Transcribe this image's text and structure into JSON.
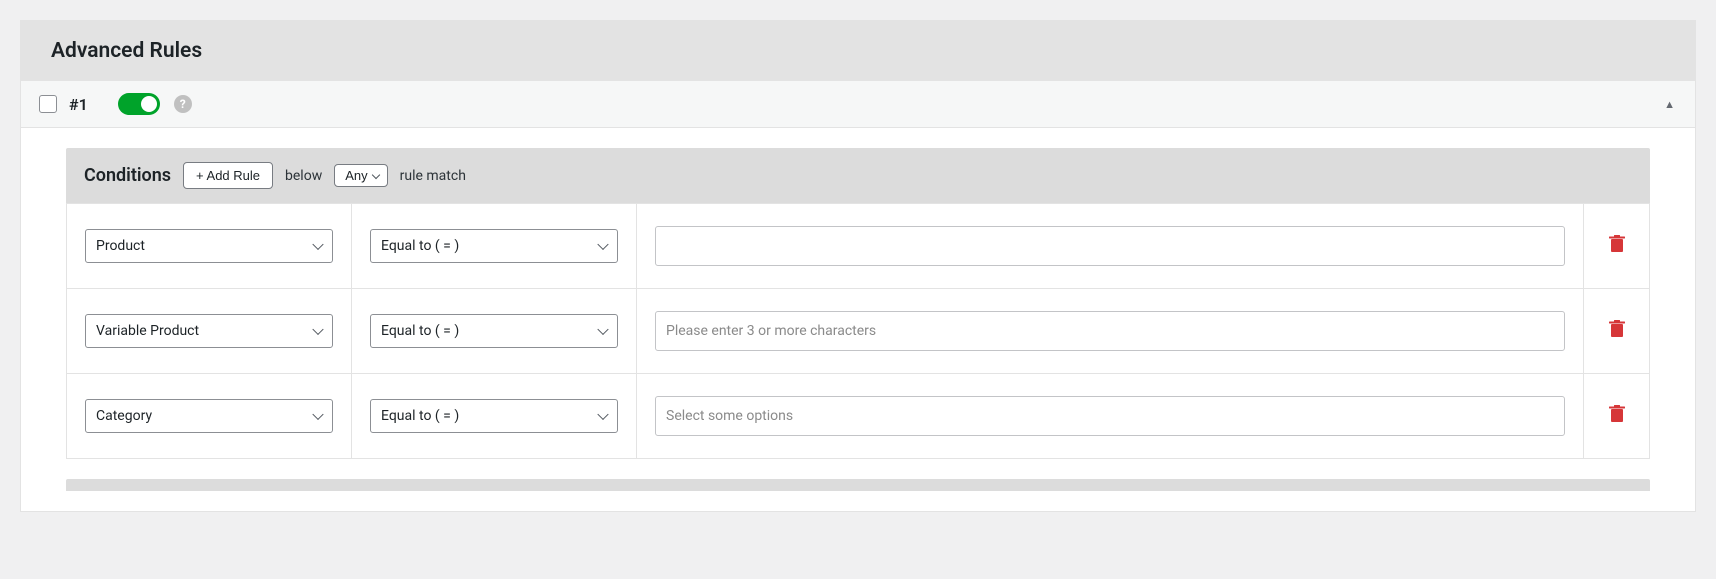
{
  "panel": {
    "title": "Advanced Rules"
  },
  "rule": {
    "number": "#1",
    "enabled": true
  },
  "conditions": {
    "title": "Conditions",
    "add_rule_label": "+ Add Rule",
    "below_text": "below",
    "match_mode": "Any",
    "rule_match_text": "rule match",
    "rows": [
      {
        "field": "Product",
        "operator": "Equal to ( = )",
        "value_placeholder": ""
      },
      {
        "field": "Variable Product",
        "operator": "Equal to ( = )",
        "value_placeholder": "Please enter 3 or more characters"
      },
      {
        "field": "Category",
        "operator": "Equal to ( = )",
        "value_placeholder": "Select some options"
      }
    ]
  }
}
